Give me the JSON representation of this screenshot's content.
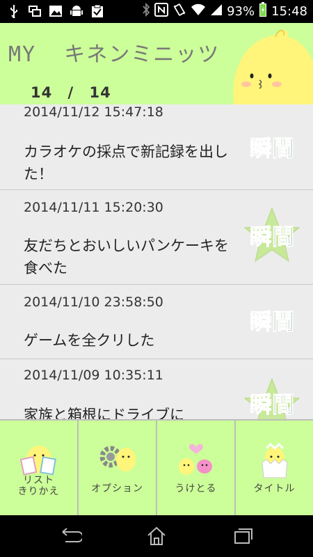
{
  "status_bar": {
    "battery_text": "93%",
    "time": "15:48",
    "icons": [
      "usb-icon",
      "window-icon",
      "image-icon",
      "android-icon",
      "clipboard-icon",
      "bluetooth-icon",
      "nfc-icon",
      "vibrate-icon",
      "wifi-icon",
      "signal-icon",
      "battery-icon"
    ]
  },
  "header": {
    "title": "MY  キネンミニッツ",
    "page_current": "14",
    "page_separator": "/",
    "page_total": "14"
  },
  "entries": [
    {
      "date": "2014/11/12 15:47:18",
      "text": "カラオケの採点で新記録を出した！",
      "badge": "瞬間",
      "star": false
    },
    {
      "date": "2014/11/11 15:20:30",
      "text": "友だちとおいしいパンケーキを食べた",
      "badge": "瞬間",
      "star": true
    },
    {
      "date": "2014/11/10 23:58:50",
      "text": "ゲームを全クリした",
      "badge": "瞬間",
      "star": false
    },
    {
      "date": "2014/11/09 10:35:11",
      "text": "家族と箱根にドライブに",
      "badge": "瞬間",
      "star": true
    }
  ],
  "tabs": [
    {
      "label": "リスト\nきりかえ"
    },
    {
      "label": "オプション"
    },
    {
      "label": "うけとる"
    },
    {
      "label": "タイトル"
    }
  ],
  "colors": {
    "header_bg": "#ccff99",
    "list_bg": "#ececec",
    "badge_green": "#1f6b1f",
    "star_fill": "#c8e89a"
  }
}
